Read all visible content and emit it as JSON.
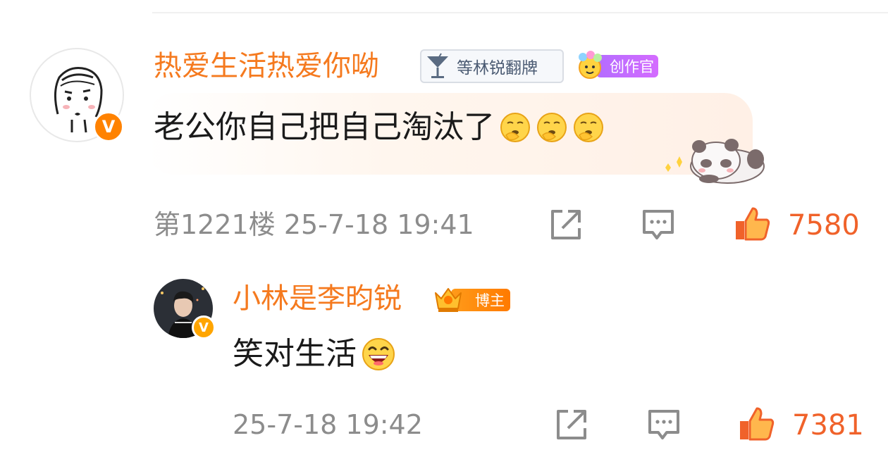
{
  "comment": {
    "username": "热爱生活热爱你呦",
    "fan_badge": "等林锐翻牌",
    "creator_badge": "创作官",
    "text": "老公你自己把自己淘汰了",
    "emojis": [
      "thinking-emoji",
      "thinking-emoji",
      "thinking-emoji"
    ],
    "floor": "第1221楼",
    "timestamp": "25-7-18 19:41",
    "likes": "7580",
    "icons": {
      "share": "share-icon",
      "reply": "comment-icon",
      "like": "thumbs-up-icon"
    }
  },
  "reply": {
    "username": "小林是李昀锐",
    "host_badge": "博主",
    "text": "笑对生活",
    "emoji": "laughing-emoji",
    "timestamp": "25-7-18 19:42",
    "likes": "7381"
  },
  "colors": {
    "username": "#f57a1f",
    "like": "#f0622a",
    "meta": "#8c8c8c",
    "verified": "#ff8200",
    "creator_badge": "#c06cff"
  }
}
